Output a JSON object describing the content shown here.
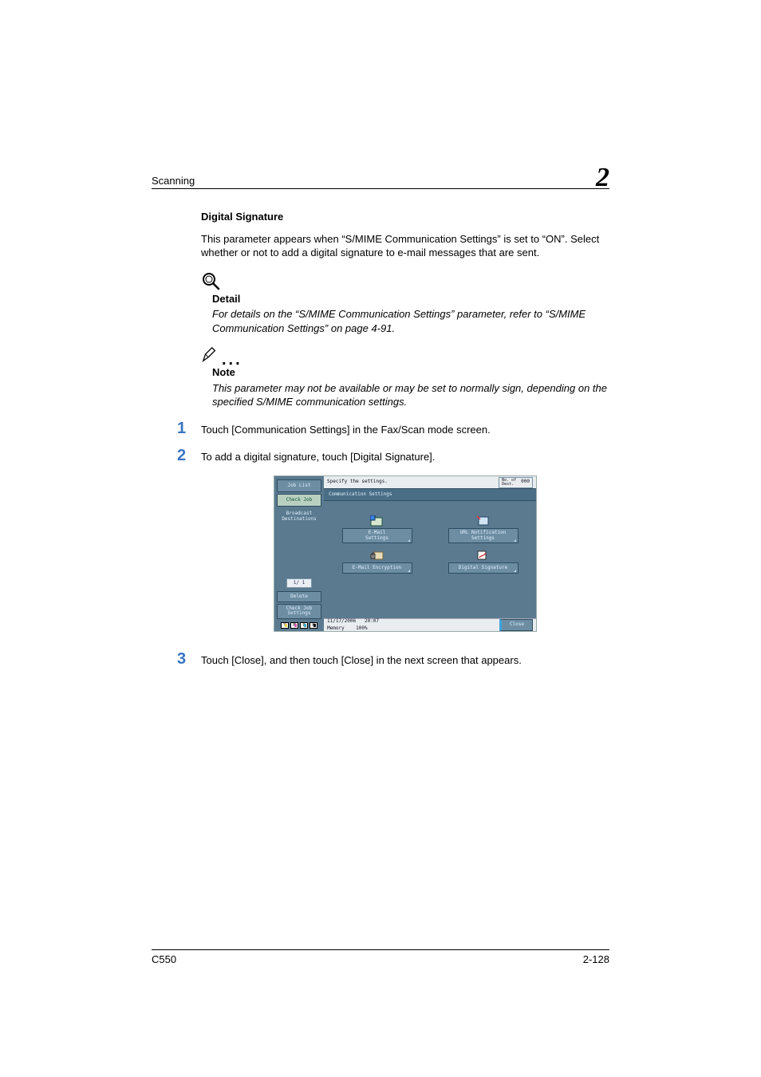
{
  "header": {
    "section": "Scanning",
    "chapter": "2"
  },
  "section_title": "Digital Signature",
  "intro": "This parameter appears when “S/MIME Communication Settings” is set to “ON”. Select whether or not to add a digital signature to e-mail messages that are sent.",
  "detail": {
    "title": "Detail",
    "body": "For details on the “S/MIME Communication Settings” parameter, refer to “S/MIME Communication Settings” on page 4-91."
  },
  "note": {
    "title": "Note",
    "body": "This parameter may not be available or may be set to normally sign, depending on the specified S/MIME communication settings."
  },
  "steps": {
    "s1_num": "1",
    "s1": "Touch [Communication Settings] in the Fax/Scan mode screen.",
    "s2_num": "2",
    "s2": "To add a digital signature, touch [Digital Signature].",
    "s3_num": "3",
    "s3": "Touch [Close], and then touch [Close] in the next screen that appears."
  },
  "panel": {
    "left": {
      "job_list": "Job List",
      "check_job": "Check Job",
      "broadcast": "Broadcast\nDestinations",
      "page_ind": "1/ 1",
      "delete": "Delete",
      "check_job_settings": "Check Job\nSettings",
      "toner": {
        "y": "Y",
        "m": "M",
        "c": "C",
        "k": "K"
      }
    },
    "top": {
      "instruction": "Specify the settings.",
      "dest_label": "No. of\nDest.",
      "dest_count": "000"
    },
    "subtitle": "Communication Settings",
    "options": {
      "email_settings": "E-Mail\nSettings",
      "url_notification": "URL Notification\nSettings",
      "email_encryption": "E-Mail Encryption",
      "digital_signature": "Digital Signature"
    },
    "bottom": {
      "date": "11/17/2006",
      "time": "20:07",
      "memory_label": "Memory",
      "memory_value": "100%",
      "close": "Close"
    }
  },
  "footer": {
    "model": "C550",
    "page": "2-128"
  }
}
